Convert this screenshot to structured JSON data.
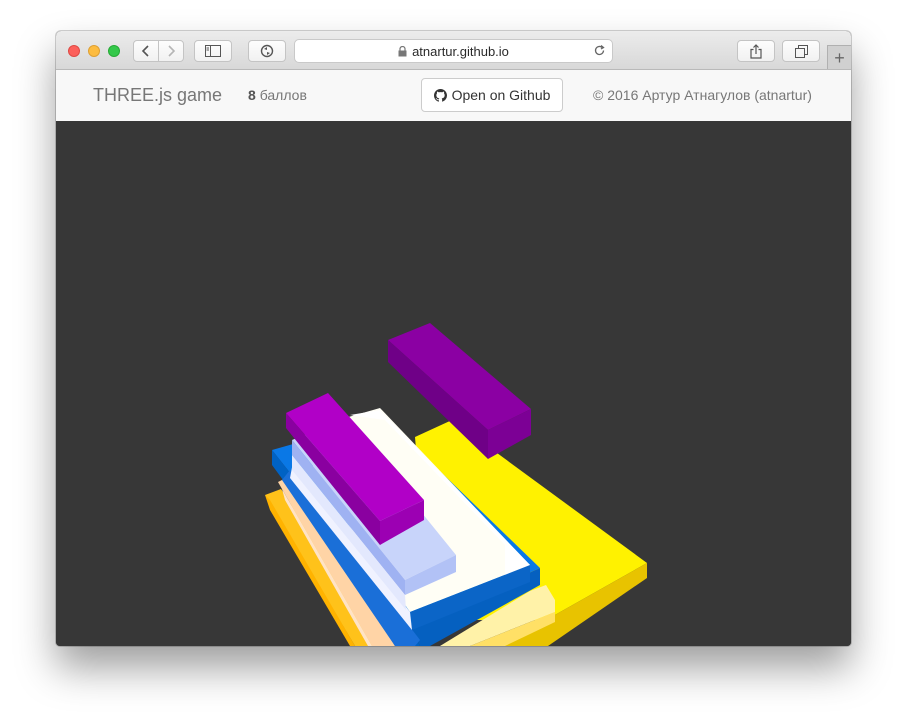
{
  "browser": {
    "address": "atnartur.github.io",
    "new_tab_symbol": "+",
    "icons": [
      "back-icon",
      "forward-icon",
      "sidebar-icon",
      "extension-icon",
      "lock-icon",
      "reload-icon",
      "share-icon",
      "tabs-icon"
    ]
  },
  "navbar": {
    "brand": "THREE.js game",
    "score_value": "8",
    "score_label": "баллов",
    "github_button": "Open on Github",
    "copyright": "© 2016 Артур Атнагулов (atnartur)"
  },
  "colors": {
    "scene_bg": "#373737",
    "purple": "#9900b0",
    "dark_purple": "#85009a",
    "yellow": "#fff200",
    "blue": "#0a78e6",
    "white": "#ffffff",
    "lavender": "#c8d4fa",
    "orange": "#ffc21a",
    "peach": "#ffd4a6"
  }
}
